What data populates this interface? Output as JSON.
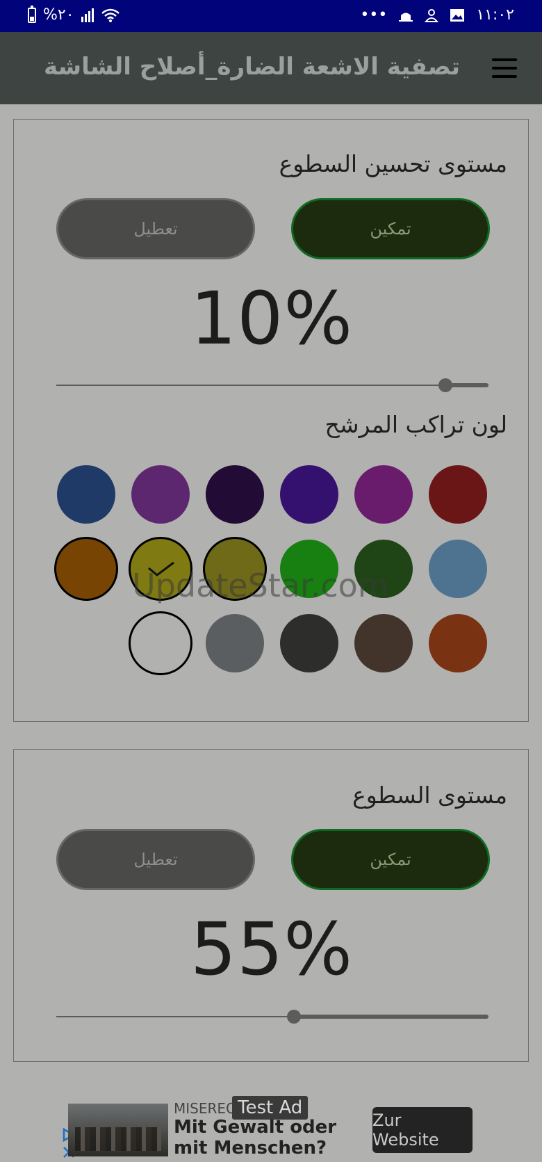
{
  "status_bar": {
    "battery_text": "%٢٠",
    "time": "١١:٠٢",
    "dots": "•••"
  },
  "app_bar": {
    "title": "تصفية الاشعة الضارة_أصلاح الشاشة"
  },
  "blue_light_card": {
    "title": "مستوى تحسين السطوع",
    "enable_label": "تمكين",
    "disable_label": "تعطيل",
    "percent_text": "10%",
    "level": 0.1,
    "color_section_label": "لون تراكب المرشح",
    "colors": [
      {
        "name": "swatch-red",
        "color": "#6a1616"
      },
      {
        "name": "swatch-magenta",
        "color": "#6a1c6c"
      },
      {
        "name": "swatch-violet",
        "color": "#34116e"
      },
      {
        "name": "swatch-dark-purple",
        "color": "#220c36"
      },
      {
        "name": "swatch-purple",
        "color": "#5c276e"
      },
      {
        "name": "swatch-blue",
        "color": "#1f3a66"
      },
      {
        "name": "swatch-light-blue",
        "color": "#4d7391"
      },
      {
        "name": "swatch-dark-green",
        "color": "#1f4516"
      },
      {
        "name": "swatch-green",
        "color": "#178010"
      },
      {
        "name": "swatch-olive",
        "color": "#6e6a18"
      },
      {
        "name": "swatch-yellow",
        "color": "#7f7a11"
      },
      {
        "name": "swatch-orange",
        "color": "#774403"
      },
      {
        "name": "swatch-deep-orange",
        "color": "#793212"
      },
      {
        "name": "swatch-brown",
        "color": "#42342b"
      },
      {
        "name": "swatch-charcoal",
        "color": "#2d2e2c"
      },
      {
        "name": "swatch-gray",
        "color": "#5b5e60"
      },
      {
        "name": "swatch-white",
        "color": "#b1b1af"
      }
    ],
    "selected_color": "swatch-yellow"
  },
  "brightness_card": {
    "title": "مستوى السطوع",
    "enable_label": "تمكين",
    "disable_label": "تعطيل",
    "percent_text": "55%",
    "level": 0.55
  },
  "watermark": "UpdateStar.com",
  "ad": {
    "advertiser": "MISEREOR",
    "badge": "Test Ad",
    "headline": "Mit Gewalt oder mit Menschen?",
    "cta": "Zur Website"
  }
}
